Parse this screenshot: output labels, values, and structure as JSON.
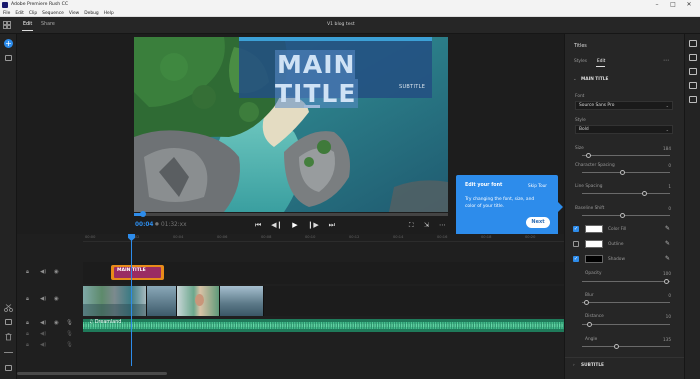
{
  "window": {
    "title": "Adobe Premiere Rush CC"
  },
  "menu": [
    "File",
    "Edit",
    "Clip",
    "Sequence",
    "View",
    "Debug",
    "Help"
  ],
  "topbar": {
    "tabs": [
      "Edit",
      "Share"
    ],
    "project_name": "V1 blog test"
  },
  "preview": {
    "main_title": "MAIN TITLE",
    "subtitle": "SUBTITLE",
    "current_time": "00:04",
    "divider": "●",
    "duration": "01:32:xx"
  },
  "callout": {
    "heading": "Edit your font",
    "skip": "Skip Tour",
    "body": "Try changing the font, size, and color of your title.",
    "next": "Next"
  },
  "panel": {
    "title": "Titles",
    "tabs": [
      "Styles",
      "Edit"
    ],
    "section": "MAIN TITLE",
    "font_label": "Font",
    "font_value": "Source Sans Pro",
    "style_label": "Style",
    "style_value": "Bold",
    "sliders": [
      {
        "label": "Size",
        "value": "184",
        "fraction": 0.05
      },
      {
        "label": "Character Spacing",
        "value": "0",
        "fraction": 0.45
      },
      {
        "label": "Line Spacing",
        "value": "1",
        "fraction": 0.72
      },
      {
        "label": "Baseline Shift",
        "value": "0",
        "fraction": 0.45
      }
    ],
    "fills": [
      {
        "label": "Color Fill",
        "checked": true,
        "color": "#ffffff"
      },
      {
        "label": "Outline",
        "checked": false,
        "color": "#ffffff"
      },
      {
        "label": "Shadow",
        "checked": true,
        "color": "#000000"
      }
    ],
    "shadow_sliders": [
      {
        "label": "Opacity",
        "value": "100",
        "fraction": 0.98
      },
      {
        "label": "Blur",
        "value": "0",
        "fraction": 0.02
      },
      {
        "label": "Distance",
        "value": "10",
        "fraction": 0.06
      },
      {
        "label": "Angle",
        "value": "135",
        "fraction": 0.38
      }
    ],
    "collapsed_section": "SUBTITLE"
  },
  "timeline": {
    "title_clip": "MAIN TITLE",
    "audio_clip": "Dreamland",
    "ruler_ticks": [
      "00:00",
      "00:02",
      "00:04",
      "00:06",
      "00:08",
      "00:10",
      "00:12",
      "00:14",
      "00:16",
      "00:18",
      "00:20"
    ]
  },
  "colors": {
    "accent": "#2d8ceb",
    "title_clip": "#e88b1a",
    "audio": "#1f7a5a"
  }
}
